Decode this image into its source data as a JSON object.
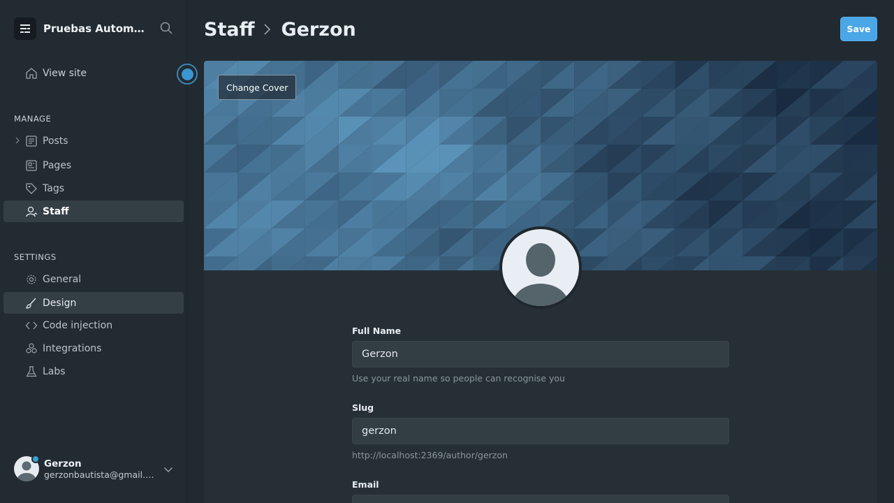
{
  "sidebar": {
    "site_title": "Pruebas Automatización",
    "view_site": "View site",
    "manage_label": "MANAGE",
    "settings_label": "SETTINGS",
    "manage_items": [
      {
        "label": "Posts",
        "icon": "posts-icon"
      },
      {
        "label": "Pages",
        "icon": "pages-icon"
      },
      {
        "label": "Tags",
        "icon": "tag-icon"
      },
      {
        "label": "Staff",
        "icon": "staff-icon"
      }
    ],
    "settings_items": [
      {
        "label": "General",
        "icon": "gear-icon"
      },
      {
        "label": "Design",
        "icon": "brush-icon"
      },
      {
        "label": "Code injection",
        "icon": "code-icon"
      },
      {
        "label": "Integrations",
        "icon": "integrations-icon"
      },
      {
        "label": "Labs",
        "icon": "flask-icon"
      }
    ],
    "user": {
      "name": "Gerzon",
      "email": "gerzonbautista@gmail.com"
    }
  },
  "header": {
    "crumb_parent": "Staff",
    "crumb_current": "Gerzon",
    "save_label": "Save"
  },
  "cover": {
    "change_label": "Change Cover"
  },
  "form": {
    "full_name": {
      "label": "Full Name",
      "value": "Gerzon",
      "hint": "Use your real name so people can recognise you"
    },
    "slug": {
      "label": "Slug",
      "value": "gerzon",
      "hint": "http://localhost:2369/author/gerzon"
    },
    "email": {
      "label": "Email"
    }
  },
  "colors": {
    "accent": "#4aa6e6",
    "sidebar_bg": "#222b32",
    "main_bg": "#212a31"
  }
}
